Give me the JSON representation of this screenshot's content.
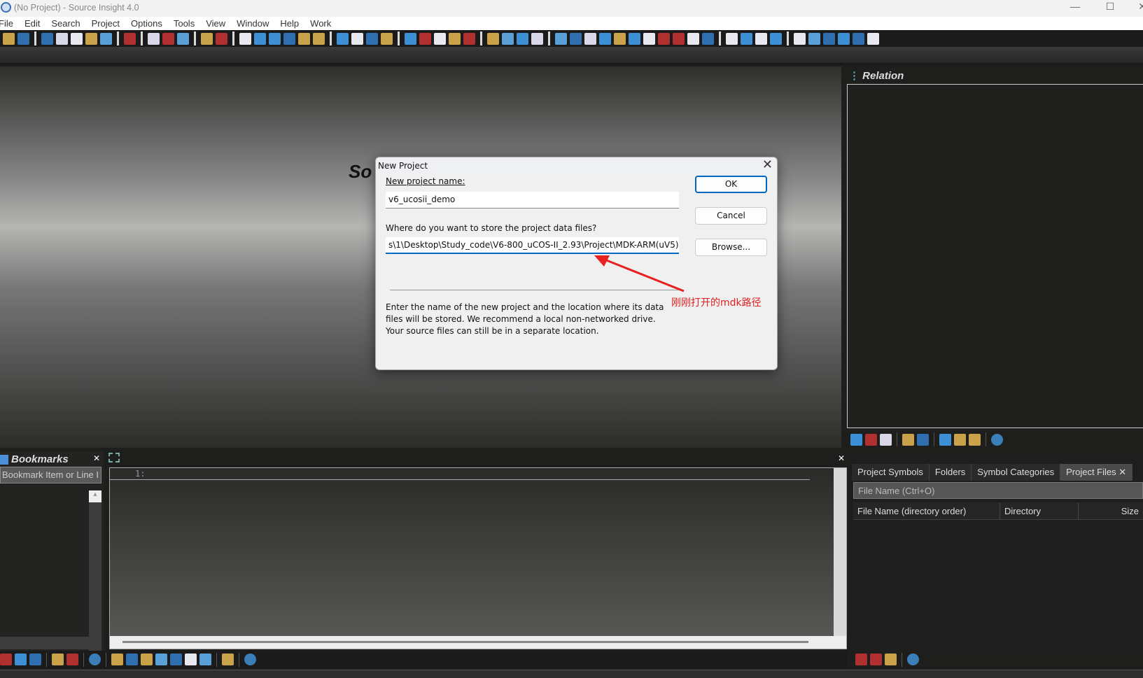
{
  "window": {
    "title": "(No Project) - Source Insight 4.0",
    "minimize": "—",
    "maximize": "☐",
    "close": "✕"
  },
  "menu": [
    "File",
    "Edit",
    "Search",
    "Project",
    "Options",
    "Tools",
    "View",
    "Window",
    "Help",
    "Work"
  ],
  "main_toolbar": [
    [
      "back-icon",
      "forward-icon"
    ],
    [
      "new-file-icon",
      "open-file-icon",
      "save-icon",
      "save-all-icon",
      "close-file-icon"
    ],
    [
      "print-icon"
    ],
    [
      "cut-icon",
      "copy-icon",
      "paste-icon"
    ],
    [
      "undo-icon",
      "redo-icon"
    ],
    [
      "search-icon",
      "search-backward-icon",
      "search-forward-icon",
      "search-files-icon",
      "replace-icon",
      "browse-symbol-icon"
    ],
    [
      "jump-back-icon",
      "jump-forward-icon",
      "select-window-icon",
      "bookmark-icon"
    ],
    [
      "reference-icon",
      "symbol-info-icon",
      "book-icon",
      "function-icon",
      "r-icon"
    ],
    [
      "tile-icon",
      "layout-icon",
      "layout2-icon",
      "cascade-icon"
    ],
    [
      "project-window-icon",
      "context-window-icon",
      "relation-window-icon",
      "symbol-window-icon",
      "folders-icon",
      "help-icon",
      "windows-icon",
      "globe-icon",
      "bird-icon",
      "sync-icon",
      "panel-icon"
    ],
    [
      "expand-icon",
      "add-item-icon",
      "remove-item-icon",
      "delete-icon"
    ],
    [
      "mark-a-icon",
      "mark-b-icon",
      "mark-c-icon",
      "mark-d-icon",
      "folder-mark-icon",
      "new-mark-icon"
    ]
  ],
  "splash_text": "So",
  "relation": {
    "title": "Relation",
    "toolbar": [
      [
        "reference-icon",
        "symbol-info-icon",
        "r-icon"
      ],
      [
        "lock-icon",
        "refresh-icon"
      ],
      [
        "list-view-icon",
        "graph-view-icon",
        "tree-view-icon"
      ],
      [
        "gear-icon"
      ]
    ]
  },
  "bookmarks": {
    "title": "Bookmarks",
    "close": "✕",
    "input_placeholder": "Bookmark Item or Line I"
  },
  "editor": {
    "line_number": "1:",
    "close": "✕"
  },
  "bottom_toolbar": [
    [
      "add-bookmark-icon",
      "remove-bookmark-icon",
      "goto-bookmark-icon"
    ],
    [
      "open-folder-icon",
      "save-icon"
    ],
    [
      "gear-icon"
    ],
    [
      "back-icon",
      "forward-icon",
      "reference-icon",
      "symbol-info-icon",
      "book-icon",
      "r-icon",
      "relation-icon"
    ],
    [
      "lock-icon"
    ],
    [
      "gear-icon"
    ]
  ],
  "project_files": {
    "tabs": [
      "Project Symbols",
      "Folders",
      "Symbol Categories",
      "Project Files ✕"
    ],
    "active_tab": 3,
    "filter_placeholder": "File Name (Ctrl+O)",
    "columns": [
      "File Name (directory order)",
      "Directory",
      "Size"
    ],
    "toolbar": [
      [
        "open-project-icon",
        "new-project-icon",
        "file-list-icon"
      ],
      [
        "gear-icon"
      ]
    ]
  },
  "dialog": {
    "title": "New Project",
    "close": "✕",
    "name_label": "New project name:",
    "name_value": "v6_ucosii_demo",
    "location_label": "Where do you want to store the project data files?",
    "location_value": "s\\1\\Desktop\\Study_code\\V6-800_uCOS-II_2.93\\Project\\MDK-ARM(uV5)",
    "ok": "OK",
    "cancel": "Cancel",
    "browse": "Browse...",
    "description": "Enter the name of the new project and the location where its data files will be stored. We recommend a local non-networked drive. Your source files can still be in a separate location."
  },
  "annotation": {
    "text": "刚刚打开的mdk路径",
    "color": "#e02020"
  }
}
